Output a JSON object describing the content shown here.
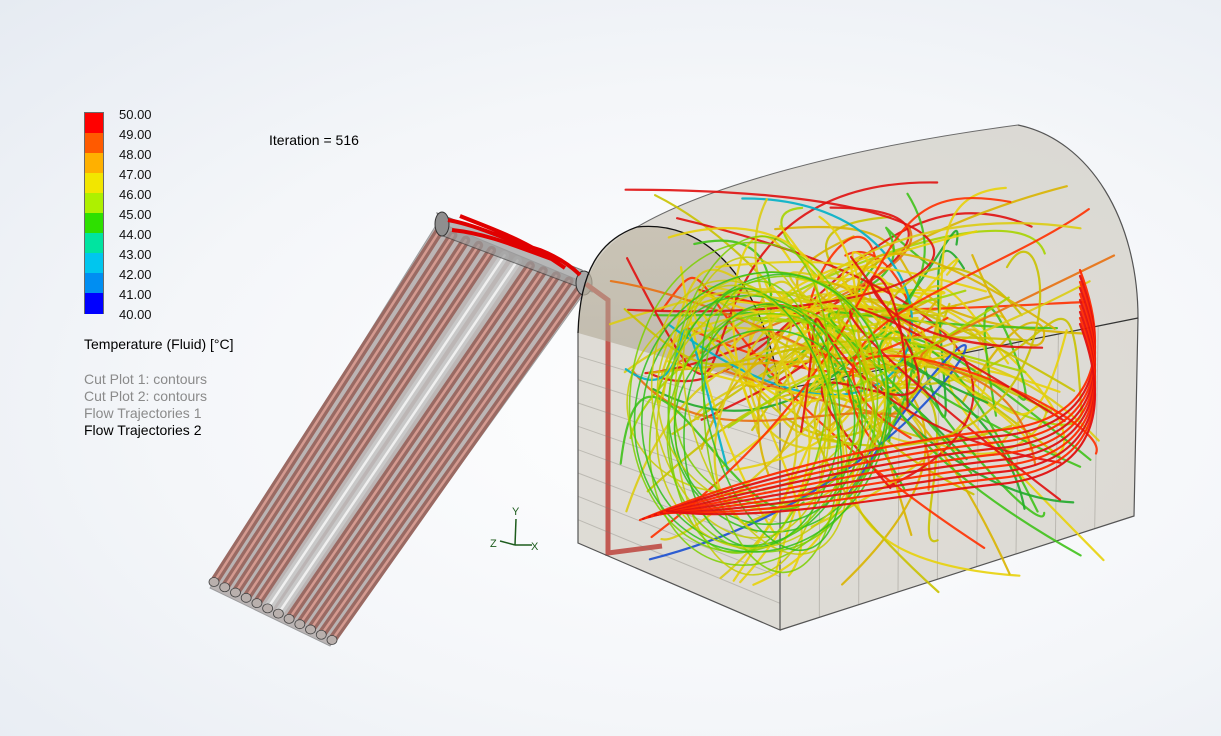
{
  "iteration": "Iteration = 516",
  "legend": {
    "title": "Temperature (Fluid) [°C]",
    "ticks": [
      "50.00",
      "49.00",
      "48.00",
      "47.00",
      "46.00",
      "45.00",
      "44.00",
      "43.00",
      "42.00",
      "41.00",
      "40.00"
    ],
    "colors": [
      "#ff0000",
      "#ff5a00",
      "#ffb000",
      "#f2e600",
      "#aef000",
      "#2ee000",
      "#00e4a0",
      "#00c6ee",
      "#008ef2",
      "#0000ff"
    ]
  },
  "plots": [
    {
      "label": "Cut Plot 1: contours",
      "active": false
    },
    {
      "label": "Cut Plot 2: contours",
      "active": false
    },
    {
      "label": "Flow Trajectories 1",
      "active": false
    },
    {
      "label": "Flow Trajectories 2",
      "active": true
    }
  ],
  "triad": {
    "y": "Y",
    "z": "Z",
    "x": "X"
  }
}
